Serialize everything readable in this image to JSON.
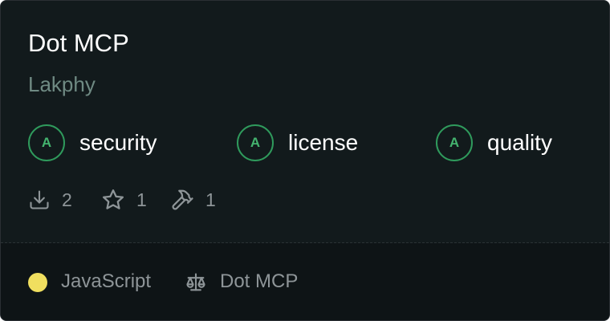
{
  "card": {
    "title": "Dot MCP",
    "author": "Lakphy",
    "grades": [
      {
        "grade": "A",
        "label": "security"
      },
      {
        "grade": "A",
        "label": "license"
      },
      {
        "grade": "A",
        "label": "quality"
      }
    ],
    "stats": {
      "downloads": "2",
      "stars": "1",
      "tools": "1"
    },
    "language": {
      "name": "JavaScript",
      "color": "#f0df5f"
    },
    "license": "Dot MCP"
  },
  "colors": {
    "background": "#121a1c",
    "footer_background": "#0e1416",
    "grade_accent": "#2f9a5c",
    "muted_text": "#8e9598",
    "author_text": "#6f8a83"
  },
  "icons": {
    "downloads": "download-icon",
    "stars": "star-icon",
    "tools": "hammer-icon",
    "license": "scale-icon"
  }
}
